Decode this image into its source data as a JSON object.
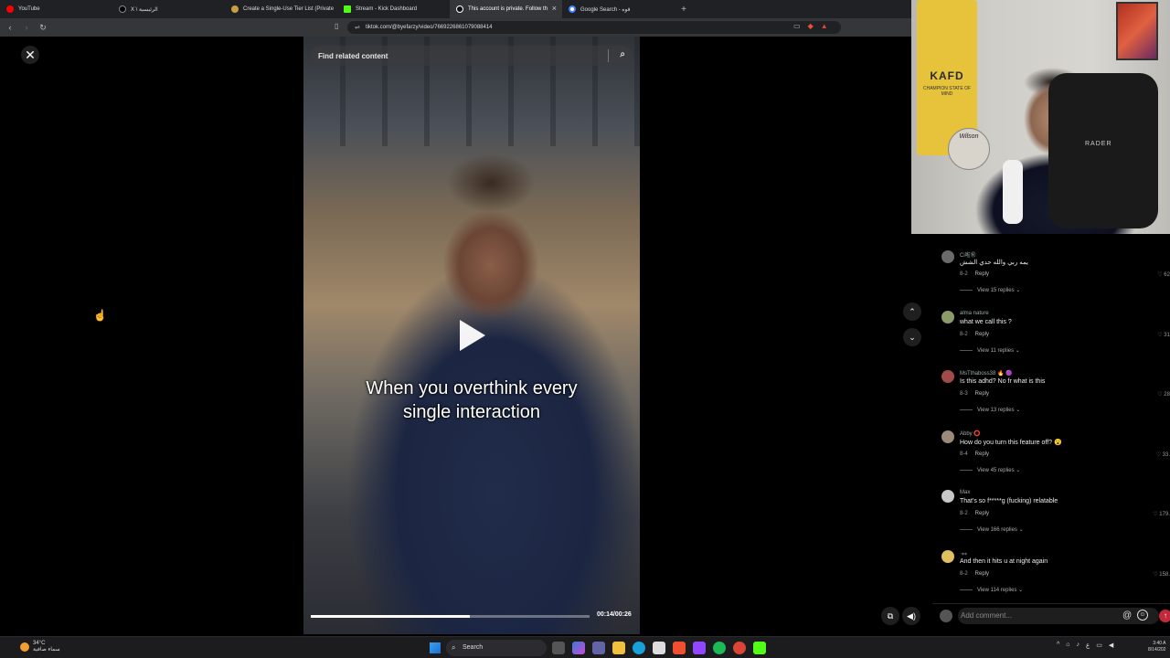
{
  "tabs": [
    {
      "title": "YouTube",
      "color": "#ff0000",
      "active": false
    },
    {
      "title": "X \\ الرئيسية",
      "color": "#000000",
      "active": false
    },
    {
      "title": "Create a Single-Use Tier List (Private",
      "color": "#c8a040",
      "active": false
    },
    {
      "title": "Stream - Kick Dashboard",
      "color": "#53fc18",
      "active": false
    },
    {
      "title": "This account is private. Follow th",
      "color": "#ffffff",
      "active": true
    },
    {
      "title": "Google Search - قوه",
      "color": "#4285f4",
      "active": false
    }
  ],
  "address": {
    "url": "tiktok.com/@byefarzy/video/7669226861079088414"
  },
  "video": {
    "search_placeholder": "Find related content",
    "caption_line1": "When you overthink every",
    "caption_line2": "single interaction",
    "time": "00:14/00:26",
    "progress": 0.57
  },
  "comments": [
    {
      "user": "Ci啦㊗",
      "text": "يمه ربي والله حدي الشش",
      "date": "8-2",
      "reply": "Reply",
      "likes": "♡ 62",
      "view": "View 15 replies ⌄",
      "avatar_color": "#6a6a6a"
    },
    {
      "user": "alma nature",
      "text": "what we call this ?",
      "date": "8-2",
      "reply": "Reply",
      "likes": "♡ 31",
      "view": "View 11 replies ⌄",
      "avatar_color": "#8a9a6a"
    },
    {
      "user": "MsTthaboss38 🔥 🟣",
      "text": "Is this adhd? No fr what is this",
      "date": "8-3",
      "reply": "Reply",
      "likes": "♡ 28",
      "view": "View 13 replies ⌄",
      "avatar_color": "#a04a4a"
    },
    {
      "user": "Abby ⭕",
      "text": "How do you turn this feature off? 😮",
      "date": "8-4",
      "reply": "Reply",
      "likes": "♡ 33.",
      "view": "View 45 replies ⌄",
      "avatar_color": "#9a8a7a"
    },
    {
      "user": "Max",
      "text": "That's so f*****g (fucking) relatable",
      "date": "8-2",
      "reply": "Reply",
      "likes": "♡ 179.",
      "view": "View 166 replies ⌄",
      "avatar_color": "#c8c8c8"
    },
    {
      "user": "·⁎⁎",
      "text": "And then it hits u at night again",
      "date": "8-2",
      "reply": "Reply",
      "likes": "♡ 158.",
      "view": "View 114 replies ⌄",
      "avatar_color": "#e0c060"
    }
  ],
  "comment_bar": {
    "placeholder": "Add comment..."
  },
  "webcam": {
    "jersey_text": "KAFD",
    "jersey_sub": "CHAMPION STATE OF MIND",
    "ball_text": "Wilson",
    "chair_text": "RADER"
  },
  "taskbar": {
    "temp": "34°C",
    "weather": "سماء صافية",
    "search_label": "Search",
    "clock_time": "3:40 A",
    "clock_date": "8/14/202"
  }
}
